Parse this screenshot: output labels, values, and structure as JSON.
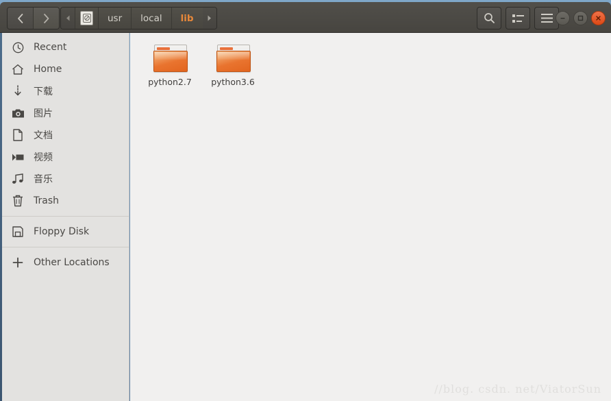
{
  "window": {
    "controls": {
      "minimize_label": "–",
      "maximize_label": "□",
      "close_label": "×"
    }
  },
  "toolbar": {
    "back_name": "back-button",
    "forward_name": "forward-button",
    "scroll_left_label": "◂",
    "scroll_right_label": "▸",
    "search_label": "",
    "view_list_label": "",
    "menu_label": ""
  },
  "breadcrumb": {
    "device_icon": "hard-disk-icon",
    "items": [
      {
        "label": "usr",
        "current": false
      },
      {
        "label": "local",
        "current": false
      },
      {
        "label": "lib",
        "current": true
      }
    ]
  },
  "sidebar": {
    "groups": [
      {
        "items": [
          {
            "label": "Recent",
            "icon": "clock-icon"
          },
          {
            "label": "Home",
            "icon": "home-icon"
          },
          {
            "label": "下载",
            "icon": "download-icon"
          },
          {
            "label": "图片",
            "icon": "camera-icon"
          },
          {
            "label": "文档",
            "icon": "document-icon"
          },
          {
            "label": "视频",
            "icon": "video-icon"
          },
          {
            "label": "音乐",
            "icon": "music-icon"
          },
          {
            "label": "Trash",
            "icon": "trash-icon"
          }
        ]
      },
      {
        "items": [
          {
            "label": "Floppy Disk",
            "icon": "floppy-disk-icon"
          }
        ]
      },
      {
        "items": [
          {
            "label": "Other Locations",
            "icon": "plus-icon"
          }
        ]
      }
    ]
  },
  "content": {
    "files": [
      {
        "name": "python2.7",
        "type": "folder"
      },
      {
        "name": "python3.6",
        "type": "folder"
      }
    ]
  },
  "watermark": {
    "text": "//blog. csdn. net/ViatorSun"
  },
  "colors": {
    "header_bg": "#4b4945",
    "sidebar_bg": "#e3e2e0",
    "content_bg": "#f1f0ef",
    "accent_orange": "#e8883a",
    "close_button": "#dd4814",
    "folder_orange": "#e9742f"
  }
}
